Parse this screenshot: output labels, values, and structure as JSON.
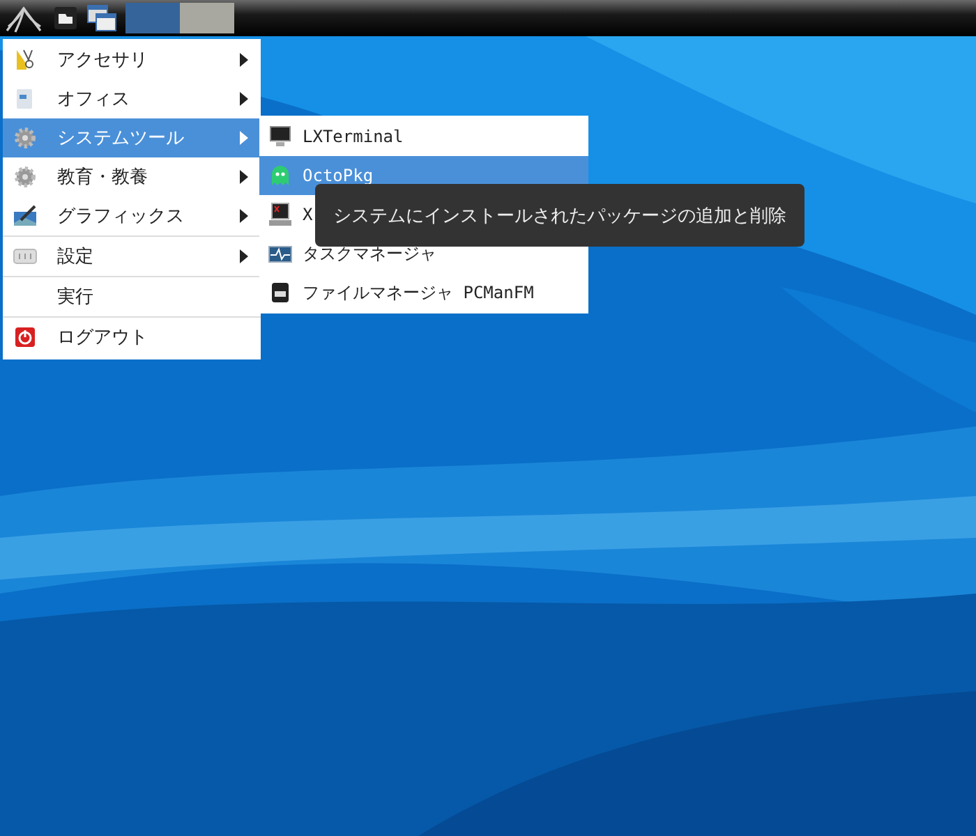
{
  "taskbar": {
    "task_buttons": [
      {
        "selected": true
      },
      {
        "selected": false
      }
    ]
  },
  "menu": {
    "items": [
      {
        "label": "アクセサリ",
        "has_submenu": true,
        "selected": false,
        "divider_after": false
      },
      {
        "label": "オフィス",
        "has_submenu": true,
        "selected": false,
        "divider_after": false
      },
      {
        "label": "システムツール",
        "has_submenu": true,
        "selected": true,
        "divider_after": false
      },
      {
        "label": "教育・教養",
        "has_submenu": true,
        "selected": false,
        "divider_after": false
      },
      {
        "label": "グラフィックス",
        "has_submenu": true,
        "selected": false,
        "divider_after": true
      },
      {
        "label": "設定",
        "has_submenu": true,
        "selected": false,
        "divider_after": true
      },
      {
        "label": "実行",
        "has_submenu": false,
        "selected": false,
        "divider_after": true
      },
      {
        "label": "ログアウト",
        "has_submenu": false,
        "selected": false,
        "divider_after": false
      }
    ]
  },
  "submenu": {
    "items": [
      {
        "label": "LXTerminal",
        "selected": false
      },
      {
        "label": "OctoPkg",
        "selected": true
      },
      {
        "label": "X",
        "selected": false
      },
      {
        "label": "タスクマネージャ",
        "selected": false
      },
      {
        "label": "ファイルマネージャ PCManFM",
        "selected": false
      }
    ]
  },
  "tooltip": {
    "text": "システムにインストールされたパッケージの追加と削除"
  }
}
